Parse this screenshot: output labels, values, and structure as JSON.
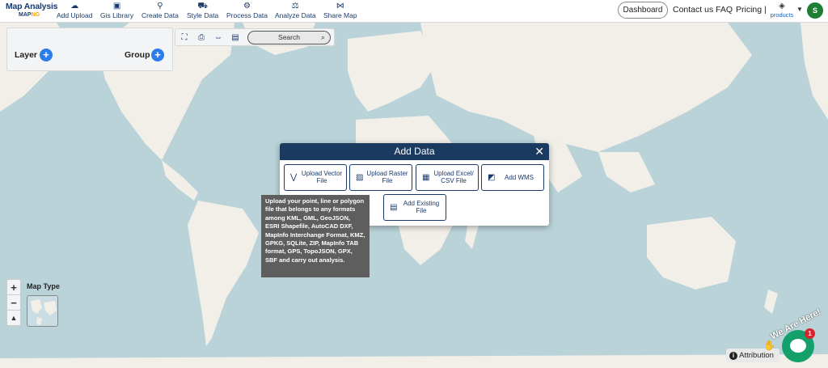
{
  "brand": {
    "title": "Map Analysis",
    "sub_prefix": "MAP",
    "sub_suffix": "NG"
  },
  "nav": [
    {
      "label": "Add Upload",
      "icon": "cloud-upload-icon"
    },
    {
      "label": "Gis Library",
      "icon": "library-icon"
    },
    {
      "label": "Create Data",
      "icon": "pin-icon"
    },
    {
      "label": "Style Data",
      "icon": "paint-icon"
    },
    {
      "label": "Process Data",
      "icon": "process-icon"
    },
    {
      "label": "Analyze Data",
      "icon": "analyze-icon"
    },
    {
      "label": "Share Map",
      "icon": "share-icon"
    }
  ],
  "right_nav": {
    "dashboard": "Dashboard",
    "contact": "Contact us",
    "faq": "FAQ",
    "pricing": "Pricing |",
    "products": "products",
    "avatar_initial": "S"
  },
  "layer_panel": {
    "layer_label": "Layer",
    "group_label": "Group"
  },
  "map_tools": {
    "search_placeholder": "Search"
  },
  "map_type": {
    "label": "Map Type"
  },
  "modal": {
    "title": "Add Data",
    "options": [
      {
        "label": "Upload Vector File",
        "icon": "vector-icon"
      },
      {
        "label": "Upload Raster File",
        "icon": "raster-icon"
      },
      {
        "label": "Upload Excel/ CSV File",
        "icon": "table-icon"
      },
      {
        "label": "Add WMS",
        "icon": "wms-icon"
      },
      {
        "label": "Add Existing File",
        "icon": "file-icon"
      }
    ]
  },
  "tooltip": {
    "text": "Upload your point, line or polygon file that belongs to any formats among KML, GML, GeoJSON, ESRI Shapefile, AutoCAD DXF, MapInfo Interchange Format, KMZ, GPKG, SQLite, ZIP, MapInfo TAB format, GPS, TopoJSON, GPX, SBF and carry out analysis."
  },
  "attribution": "Attribution",
  "chat": {
    "tagline": "We Are Here!",
    "badge": "1"
  },
  "colors": {
    "navy": "#1a3a6b",
    "modal_header": "#1a3a5f",
    "accent_blue": "#2b7de9",
    "chat_green": "#14a06b",
    "ocean": "#b9d3d9",
    "land": "#f2efe9"
  }
}
